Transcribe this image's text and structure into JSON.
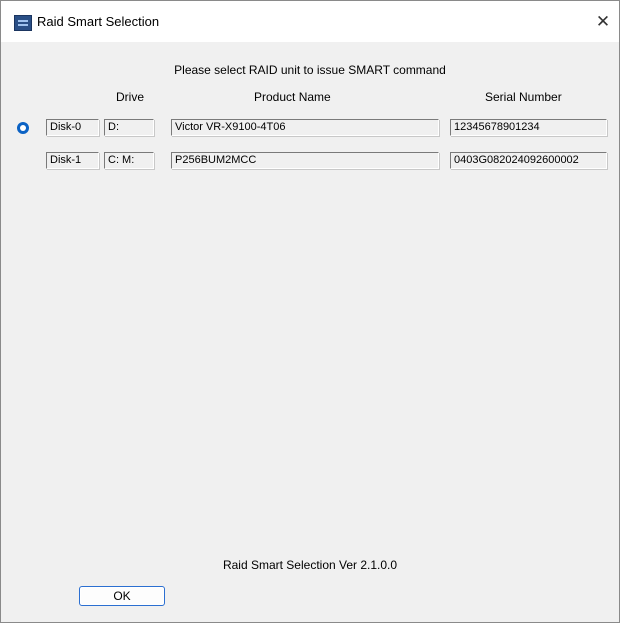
{
  "window": {
    "title": "Raid Smart Selection",
    "close_glyph": "✕",
    "icon": "app-icon"
  },
  "instruction": "Please select RAID unit to issue SMART command",
  "columns": {
    "drive": "Drive",
    "product_name": "Product Name",
    "serial_number": "Serial Number"
  },
  "disks": [
    {
      "disk": "Disk-0",
      "drive": "D:",
      "product_name": "Victor  VR-X9100-4T06",
      "serial_number": "12345678901234",
      "selected": true
    },
    {
      "disk": "Disk-1",
      "drive": "C: M:",
      "product_name": "P256BUM2MCC",
      "serial_number": "0403G082024092600002",
      "selected": false
    }
  ],
  "version_text": "Raid Smart Selection Ver 2.1.0.0",
  "ok_label": "OK"
}
